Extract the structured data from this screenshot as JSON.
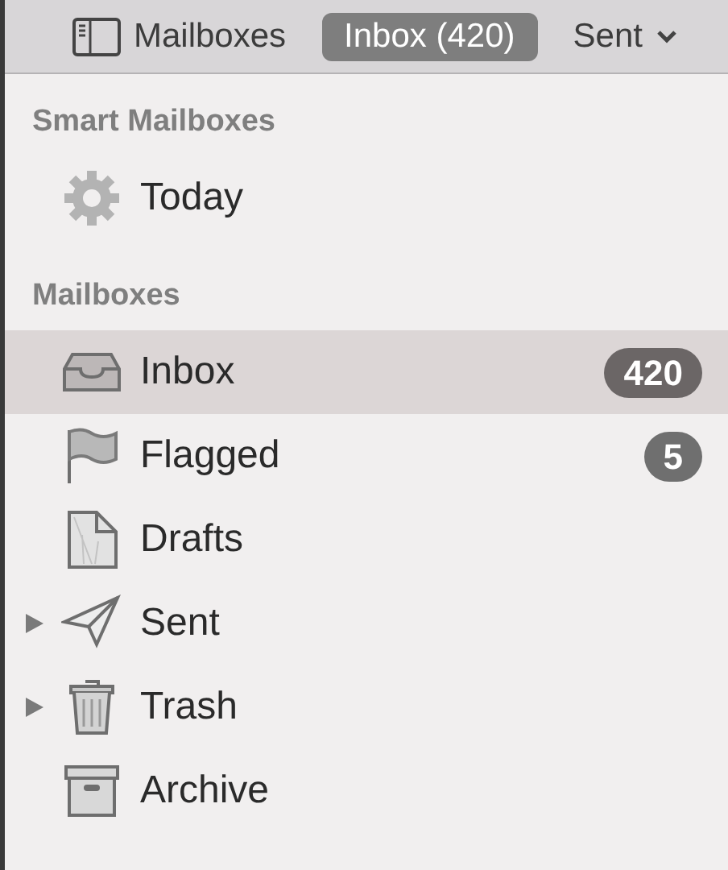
{
  "toolbar": {
    "buttons": [
      {
        "label": "Mailboxes",
        "kind": "sidebar",
        "selected": false
      },
      {
        "label": "Inbox (420)",
        "kind": "plain",
        "selected": true
      },
      {
        "label": "Sent",
        "kind": "menu",
        "selected": false
      }
    ]
  },
  "sections": [
    {
      "title": "Smart Mailboxes",
      "items": [
        {
          "label": "Today",
          "kind": "gear",
          "selected": false
        }
      ]
    },
    {
      "title": "Mailboxes",
      "items": [
        {
          "label": "Inbox",
          "kind": "inbox",
          "selected": true,
          "count": "420"
        },
        {
          "label": "Flagged",
          "kind": "flag",
          "selected": false,
          "count": "5"
        },
        {
          "label": "Drafts",
          "kind": "drafts",
          "selected": false
        },
        {
          "label": "Sent",
          "kind": "sent",
          "selected": false,
          "expanded": false
        },
        {
          "label": "Trash",
          "kind": "trash",
          "selected": false,
          "expanded": false
        },
        {
          "label": "Archive",
          "kind": "archive",
          "selected": false
        }
      ]
    }
  ]
}
